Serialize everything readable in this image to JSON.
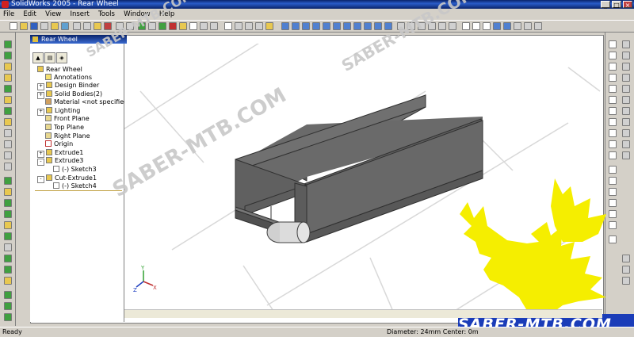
{
  "window": {
    "title": "SolidWorks 2005 - Rear Wheel"
  },
  "menu": [
    "File",
    "Edit",
    "View",
    "Insert",
    "Tools",
    "Window",
    "Help"
  ],
  "document": {
    "title": "Rear Wheel"
  },
  "feature_manager": {
    "root": "Rear Wheel",
    "items": [
      {
        "label": "Annotations",
        "expand": ""
      },
      {
        "label": "Design Binder",
        "expand": "+"
      },
      {
        "label": "Solid Bodies(2)",
        "expand": "+"
      },
      {
        "label": "Material <not specified>",
        "expand": ""
      },
      {
        "label": "Lighting",
        "expand": "+"
      },
      {
        "label": "Front Plane",
        "expand": ""
      },
      {
        "label": "Top Plane",
        "expand": ""
      },
      {
        "label": "Right Plane",
        "expand": ""
      },
      {
        "label": "Origin",
        "expand": ""
      },
      {
        "label": "Extrude1",
        "expand": "+"
      },
      {
        "label": "Extrude3",
        "expand": "-"
      },
      {
        "label": "(-) Sketch3",
        "expand": ""
      },
      {
        "label": "Cut-Extrude1",
        "expand": "-"
      },
      {
        "label": "(-) Sketch4",
        "expand": ""
      }
    ]
  },
  "status": {
    "left": "Ready",
    "right": "Diameter: 24mm  Center: 0m"
  },
  "watermark": {
    "text": "SABER-MTB.COM",
    "logo_text": "SABER-MTB.COM",
    "logo_color": "#f5ee00"
  }
}
